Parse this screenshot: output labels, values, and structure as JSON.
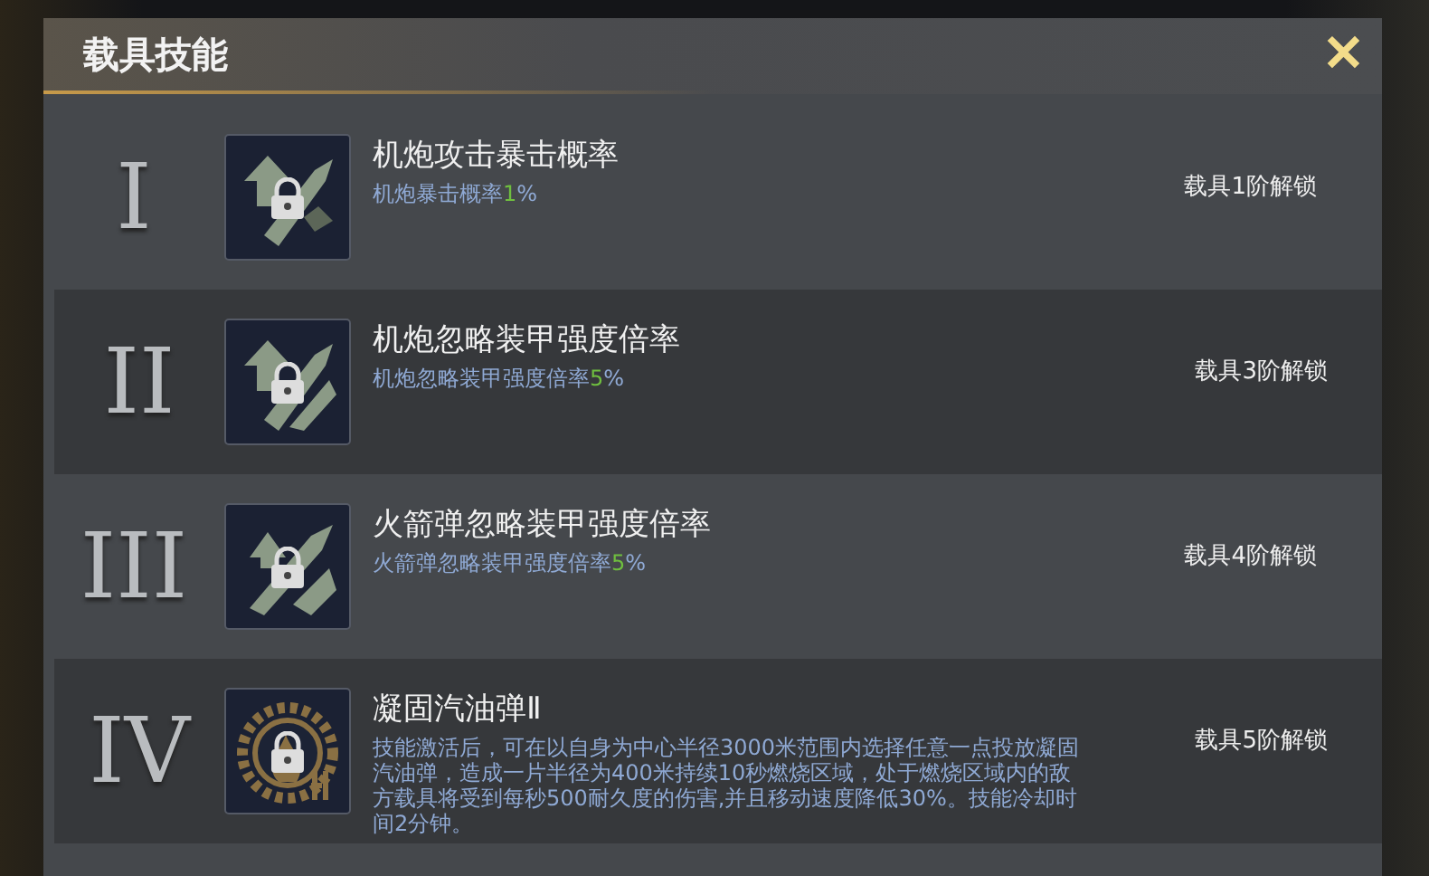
{
  "dialog": {
    "title": "载具技能",
    "close": "✕"
  },
  "skills": [
    {
      "numeral": "I",
      "locked": true,
      "name": "机炮攻击暴击概率",
      "kind": "stat",
      "description": "机炮暴击概率",
      "value": "1",
      "suffix": "%",
      "unlock": "载具1阶解锁"
    },
    {
      "numeral": "II",
      "locked": true,
      "name": "机炮忽略装甲强度倍率",
      "kind": "stat",
      "description": "机炮忽略装甲强度倍率",
      "value": "5",
      "suffix": "%",
      "unlock": "载具3阶解锁"
    },
    {
      "numeral": "III",
      "locked": true,
      "name": "火箭弹忽略装甲强度倍率",
      "kind": "stat",
      "description": "火箭弹忽略装甲强度倍率",
      "value": "5",
      "suffix": "%",
      "unlock": "载具4阶解锁"
    },
    {
      "numeral": "IV",
      "locked": true,
      "name": "凝固汽油弹Ⅱ",
      "kind": "text",
      "description": "技能激活后，可在以自身为中心半径3000米范围内选择任意一点投放凝固汽油弹，造成一片半径为400米持续10秒燃烧区域，处于燃烧区域内的敌方载具将受到每秒500耐久度的伤害,并且移动速度降低30%。技能冷却时间2分钟。",
      "unlock": "载具5阶解锁"
    }
  ]
}
